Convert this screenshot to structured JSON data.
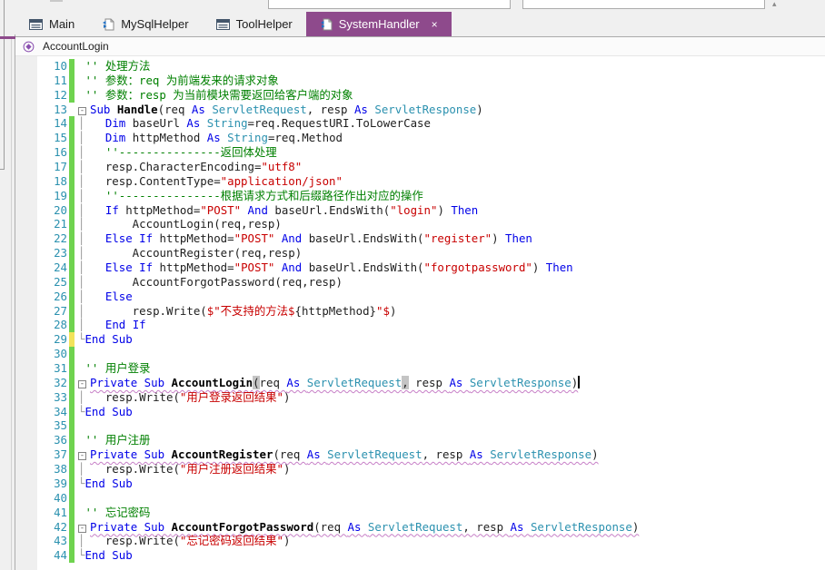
{
  "colors": {
    "active_tab": "#8E4A8C",
    "tab_underline": "#8E4A8C",
    "keyword": "#0000E8",
    "type_name": "#2B91AF",
    "string": "#C80000",
    "comment": "#008000",
    "line_number": "#2B91AF",
    "change_bar_saved": "#6FD34F",
    "change_bar_unsaved": "#F2E35B",
    "error_squiggle": "#C77FC7",
    "brace_match_highlight": "#C4C4C4"
  },
  "tab_bar": {
    "tabs": [
      {
        "label": "Main",
        "icon": "window-icon",
        "active": false
      },
      {
        "label": "MySqlHelper",
        "icon": "class-file-icon",
        "active": false
      },
      {
        "label": "ToolHelper",
        "icon": "window-icon",
        "active": false
      },
      {
        "label": "SystemHandler",
        "icon": "class-file-icon",
        "active": true,
        "close_label": "×"
      }
    ]
  },
  "navigator": {
    "member": "AccountLogin",
    "icon": "method-icon"
  },
  "editor": {
    "lines": [
      {
        "n": 10,
        "bar": "saved",
        "tokens": [
          [
            "cm",
            " '' 处理方法"
          ]
        ]
      },
      {
        "n": 11,
        "bar": "saved",
        "tokens": [
          [
            "cm",
            " '' 参数：req 为前端发来的请求对象"
          ]
        ]
      },
      {
        "n": 12,
        "bar": "saved",
        "tokens": [
          [
            "cm",
            " '' 参数：resp 为当前模块需要返回给客户端的对象"
          ]
        ]
      },
      {
        "n": 13,
        "bar": null,
        "tokens": [
          [
            "foldbox",
            "-"
          ],
          [
            "kw",
            "Sub "
          ],
          [
            "fn",
            "Handle"
          ],
          [
            "pl",
            "(req "
          ],
          [
            "kw",
            "As "
          ],
          [
            "ty",
            "ServletRequest"
          ],
          [
            "pl",
            ", resp "
          ],
          [
            "kw",
            "As "
          ],
          [
            "ty",
            "ServletResponse"
          ],
          [
            "pl",
            ")"
          ]
        ]
      },
      {
        "n": 14,
        "bar": "saved",
        "tokens": [
          [
            "fold",
            "│"
          ],
          [
            "pl",
            "   "
          ],
          [
            "kw",
            "Dim"
          ],
          [
            "pl",
            " baseUrl "
          ],
          [
            "kw",
            "As "
          ],
          [
            "ty",
            "String"
          ],
          [
            "pl",
            "=req.RequestURI.ToLowerCase"
          ]
        ]
      },
      {
        "n": 15,
        "bar": "saved",
        "tokens": [
          [
            "fold",
            "│"
          ],
          [
            "pl",
            "   "
          ],
          [
            "kw",
            "Dim"
          ],
          [
            "pl",
            " httpMethod "
          ],
          [
            "kw",
            "As "
          ],
          [
            "ty",
            "String"
          ],
          [
            "pl",
            "=req.Method"
          ]
        ]
      },
      {
        "n": 16,
        "bar": "saved",
        "tokens": [
          [
            "fold",
            "│"
          ],
          [
            "pl",
            "   "
          ],
          [
            "cm",
            "''---------------返回体处理"
          ]
        ]
      },
      {
        "n": 17,
        "bar": "saved",
        "tokens": [
          [
            "fold",
            "│"
          ],
          [
            "pl",
            "   resp.CharacterEncoding="
          ],
          [
            "str",
            "\"utf8\""
          ]
        ]
      },
      {
        "n": 18,
        "bar": "saved",
        "tokens": [
          [
            "fold",
            "│"
          ],
          [
            "pl",
            "   resp.ContentType="
          ],
          [
            "str",
            "\"application/json\""
          ]
        ]
      },
      {
        "n": 19,
        "bar": "saved",
        "tokens": [
          [
            "fold",
            "│"
          ],
          [
            "pl",
            "   "
          ],
          [
            "cm",
            "''---------------根据请求方式和后缀路径作出对应的操作"
          ]
        ]
      },
      {
        "n": 20,
        "bar": "saved",
        "tokens": [
          [
            "fold",
            "│"
          ],
          [
            "pl",
            "   "
          ],
          [
            "kw",
            "If"
          ],
          [
            "pl",
            " httpMethod="
          ],
          [
            "str",
            "\"POST\""
          ],
          [
            "pl",
            " "
          ],
          [
            "kw",
            "And"
          ],
          [
            "pl",
            " baseUrl.EndsWith("
          ],
          [
            "str",
            "\"login\""
          ],
          [
            "pl",
            ") "
          ],
          [
            "kw",
            "Then"
          ]
        ]
      },
      {
        "n": 21,
        "bar": "saved",
        "tokens": [
          [
            "fold",
            "│"
          ],
          [
            "pl",
            "       AccountLogin(req,resp)"
          ]
        ]
      },
      {
        "n": 22,
        "bar": "saved",
        "tokens": [
          [
            "fold",
            "│"
          ],
          [
            "pl",
            "   "
          ],
          [
            "kw",
            "Else If"
          ],
          [
            "pl",
            " httpMethod="
          ],
          [
            "str",
            "\"POST\""
          ],
          [
            "pl",
            " "
          ],
          [
            "kw",
            "And"
          ],
          [
            "pl",
            " baseUrl.EndsWith("
          ],
          [
            "str",
            "\"register\""
          ],
          [
            "pl",
            ") "
          ],
          [
            "kw",
            "Then"
          ]
        ]
      },
      {
        "n": 23,
        "bar": "saved",
        "tokens": [
          [
            "fold",
            "│"
          ],
          [
            "pl",
            "       AccountRegister(req,resp)"
          ]
        ]
      },
      {
        "n": 24,
        "bar": "saved",
        "tokens": [
          [
            "fold",
            "│"
          ],
          [
            "pl",
            "   "
          ],
          [
            "kw",
            "Else If"
          ],
          [
            "pl",
            " httpMethod="
          ],
          [
            "str",
            "\"POST\""
          ],
          [
            "pl",
            " "
          ],
          [
            "kw",
            "And"
          ],
          [
            "pl",
            " baseUrl.EndsWith("
          ],
          [
            "str",
            "\"forgotpassword\""
          ],
          [
            "pl",
            ") "
          ],
          [
            "kw",
            "Then"
          ]
        ]
      },
      {
        "n": 25,
        "bar": "saved",
        "tokens": [
          [
            "fold",
            "│"
          ],
          [
            "pl",
            "       AccountForgotPassword(req,resp)"
          ]
        ]
      },
      {
        "n": 26,
        "bar": "saved",
        "tokens": [
          [
            "fold",
            "│"
          ],
          [
            "pl",
            "   "
          ],
          [
            "kw",
            "Else"
          ]
        ]
      },
      {
        "n": 27,
        "bar": "saved",
        "tokens": [
          [
            "fold",
            "│"
          ],
          [
            "pl",
            "       resp.Write("
          ],
          [
            "str",
            "$\"不支持的方法$"
          ],
          [
            "pl",
            "{httpMethod}"
          ],
          [
            "str",
            "\"$"
          ],
          [
            "pl",
            ")"
          ]
        ]
      },
      {
        "n": 28,
        "bar": "saved",
        "tokens": [
          [
            "fold",
            "│"
          ],
          [
            "pl",
            "   "
          ],
          [
            "kw",
            "End If"
          ]
        ]
      },
      {
        "n": 29,
        "bar": "unsaved",
        "tokens": [
          [
            "fold",
            "└"
          ],
          [
            "kw",
            "End Sub"
          ]
        ]
      },
      {
        "n": 30,
        "bar": "saved",
        "tokens": []
      },
      {
        "n": 31,
        "bar": "saved",
        "tokens": [
          [
            "cm",
            " '' 用户登录"
          ]
        ]
      },
      {
        "n": 32,
        "bar": "saved",
        "tokens": [
          [
            "foldbox",
            "-"
          ],
          [
            "kw sq",
            "Private Sub "
          ],
          [
            "fn sq",
            "AccountLogin"
          ],
          [
            "hl sq",
            "("
          ],
          [
            "pl sq",
            "req "
          ],
          [
            "kw sq",
            "As "
          ],
          [
            "ty sq",
            "ServletRequest"
          ],
          [
            "hl sq",
            ","
          ],
          [
            "pl sq",
            " resp "
          ],
          [
            "kw sq",
            "As "
          ],
          [
            "ty sq",
            "ServletResponse"
          ],
          [
            "pl sq",
            ")"
          ],
          [
            "caret",
            ""
          ]
        ]
      },
      {
        "n": 33,
        "bar": "saved",
        "tokens": [
          [
            "fold",
            "│"
          ],
          [
            "pl",
            "   resp.Write("
          ],
          [
            "str",
            "\"用户登录返回结果\""
          ],
          [
            "pl",
            ")"
          ]
        ]
      },
      {
        "n": 34,
        "bar": "saved",
        "tokens": [
          [
            "fold",
            "└"
          ],
          [
            "kw",
            "End Sub"
          ]
        ]
      },
      {
        "n": 35,
        "bar": "saved",
        "tokens": []
      },
      {
        "n": 36,
        "bar": "saved",
        "tokens": [
          [
            "cm",
            " '' 用户注册"
          ]
        ]
      },
      {
        "n": 37,
        "bar": "saved",
        "tokens": [
          [
            "foldbox",
            "-"
          ],
          [
            "kw sq",
            "Private Sub "
          ],
          [
            "fn sq",
            "AccountRegister"
          ],
          [
            "pl sq",
            "(req "
          ],
          [
            "kw sq",
            "As "
          ],
          [
            "ty sq",
            "ServletRequest"
          ],
          [
            "pl sq",
            ", resp "
          ],
          [
            "kw sq",
            "As "
          ],
          [
            "ty sq",
            "ServletResponse"
          ],
          [
            "pl sq",
            ")"
          ]
        ]
      },
      {
        "n": 38,
        "bar": "saved",
        "tokens": [
          [
            "fold",
            "│"
          ],
          [
            "pl",
            "   resp.Write("
          ],
          [
            "str",
            "\"用户注册返回结果\""
          ],
          [
            "pl",
            ")"
          ]
        ]
      },
      {
        "n": 39,
        "bar": "saved",
        "tokens": [
          [
            "fold",
            "└"
          ],
          [
            "kw",
            "End Sub"
          ]
        ]
      },
      {
        "n": 40,
        "bar": "saved",
        "tokens": []
      },
      {
        "n": 41,
        "bar": "saved",
        "tokens": [
          [
            "cm",
            " '' 忘记密码"
          ]
        ]
      },
      {
        "n": 42,
        "bar": "saved",
        "tokens": [
          [
            "foldbox",
            "-"
          ],
          [
            "kw sq",
            "Private Sub "
          ],
          [
            "fn sq",
            "AccountForgotPassword"
          ],
          [
            "pl sq",
            "(req "
          ],
          [
            "kw sq",
            "As "
          ],
          [
            "ty sq",
            "ServletRequest"
          ],
          [
            "pl sq",
            ", resp "
          ],
          [
            "kw sq",
            "As "
          ],
          [
            "ty sq",
            "ServletResponse"
          ],
          [
            "pl sq",
            ")"
          ]
        ]
      },
      {
        "n": 43,
        "bar": "saved",
        "tokens": [
          [
            "fold",
            "│"
          ],
          [
            "pl",
            "   resp.Write("
          ],
          [
            "str",
            "\"忘记密码返回结果\""
          ],
          [
            "pl",
            ")"
          ]
        ]
      },
      {
        "n": 44,
        "bar": "saved",
        "tokens": [
          [
            "fold",
            "└"
          ],
          [
            "kw",
            "End Sub"
          ]
        ]
      }
    ]
  }
}
